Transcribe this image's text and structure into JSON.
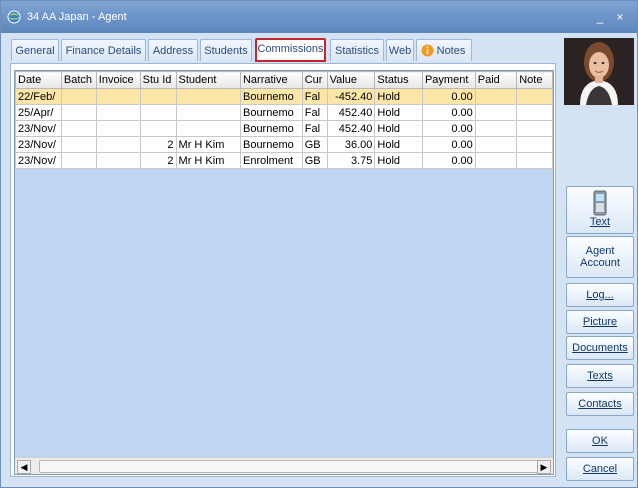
{
  "window": {
    "title": "34 AA Japan - Agent",
    "minimize": "_",
    "close": "×"
  },
  "tabs": [
    {
      "label": "General"
    },
    {
      "label": "Finance Details"
    },
    {
      "label": "Address"
    },
    {
      "label": "Students"
    },
    {
      "label": "Commissions",
      "active": true
    },
    {
      "label": "Statistics"
    },
    {
      "label": "Web"
    },
    {
      "label": "Notes"
    }
  ],
  "table": {
    "columns": [
      "Date",
      "Batch",
      "Invoice",
      "Stu Id",
      "Student",
      "Narrative",
      "Cur",
      "Value",
      "Status",
      "Payment",
      "Paid",
      "Note"
    ],
    "rows": [
      [
        "22/Feb/",
        "",
        "",
        "",
        "",
        "Bournemo",
        "Fal",
        "-452.40",
        "Hold",
        "0.00",
        "",
        ""
      ],
      [
        "25/Apr/",
        "",
        "",
        "",
        "",
        "Bournemo",
        "Fal",
        "452.40",
        "Hold",
        "0.00",
        "",
        ""
      ],
      [
        "23/Nov/",
        "",
        "",
        "",
        "",
        "Bournemo",
        "Fal",
        "452.40",
        "Hold",
        "0.00",
        "",
        ""
      ],
      [
        "23/Nov/",
        "",
        "",
        "2",
        "Mr H Kim",
        "Bournemo",
        "GB",
        "36.00",
        "Hold",
        "0.00",
        "",
        ""
      ],
      [
        "23/Nov/",
        "",
        "",
        "2",
        "Mr H Kim",
        "Enrolment",
        "GB",
        "3.75",
        "Hold",
        "0.00",
        "",
        ""
      ]
    ]
  },
  "sidebar": {
    "text_btn": "Text",
    "agent_account": "Agent Account",
    "log": "Log...",
    "picture": "Picture",
    "documents": "Documents",
    "texts": "Texts",
    "contacts": "Contacts",
    "ok": "OK",
    "cancel": "Cancel"
  }
}
